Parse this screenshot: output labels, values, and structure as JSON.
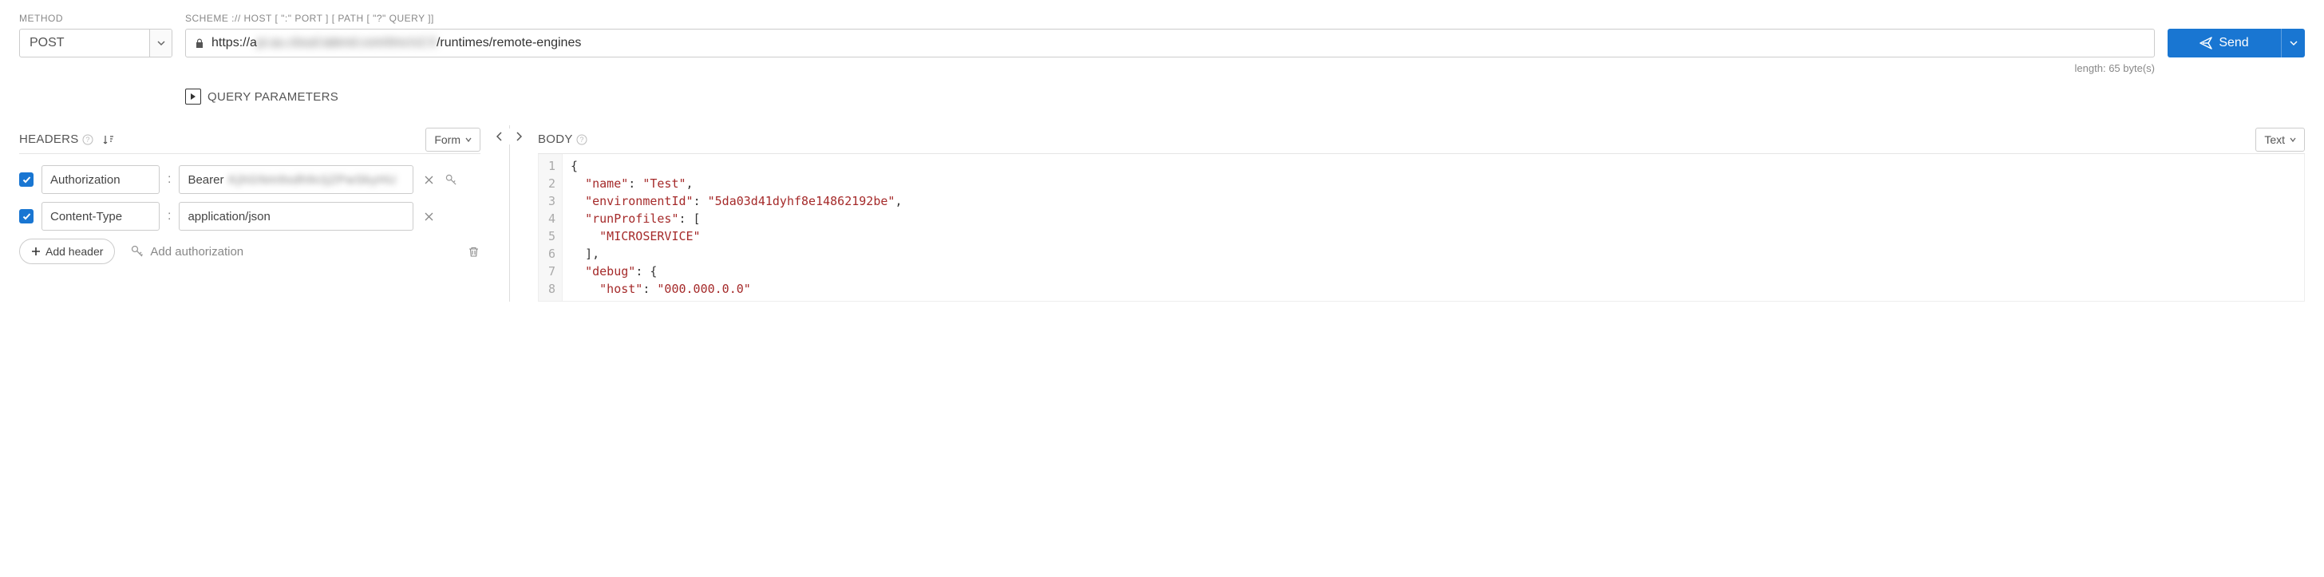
{
  "labels": {
    "method": "METHOD",
    "scheme": "SCHEME :// HOST [ \":\" PORT ] [ PATH [ \"?\" QUERY ]]",
    "query_params": "QUERY PARAMETERS",
    "headers": "HEADERS",
    "body": "BODY",
    "length": "length: 65 byte(s)"
  },
  "method": {
    "value": "POST"
  },
  "url": {
    "prefix": "https://a",
    "blurred": "pi.au.cloud.talend.com/tmc/v2.5",
    "suffix": "/runtimes/remote-engines"
  },
  "send": {
    "label": "Send"
  },
  "headers_panel": {
    "mode": "Form"
  },
  "body_panel": {
    "mode": "Text"
  },
  "headers": [
    {
      "enabled": true,
      "key": "Authorization",
      "value_prefix": "Bearer ",
      "value_blur": "KjhGNm9sdh9cljZPwSkyHU",
      "has_key_icon": true
    },
    {
      "enabled": true,
      "key": "Content-Type",
      "value_prefix": "application/json",
      "value_blur": "",
      "has_key_icon": false
    }
  ],
  "controls": {
    "add_header": "Add header",
    "add_auth": "Add authorization"
  },
  "body_code": {
    "lines": [
      [
        {
          "t": "p",
          "v": "{"
        }
      ],
      [
        {
          "t": "p",
          "v": "  "
        },
        {
          "t": "k",
          "v": "\"name\""
        },
        {
          "t": "p",
          "v": ": "
        },
        {
          "t": "s",
          "v": "\"Test\""
        },
        {
          "t": "p",
          "v": ","
        }
      ],
      [
        {
          "t": "p",
          "v": "  "
        },
        {
          "t": "k",
          "v": "\"environmentId\""
        },
        {
          "t": "p",
          "v": ": "
        },
        {
          "t": "s",
          "v": "\"5da03d41dyhf8e14862192be\""
        },
        {
          "t": "p",
          "v": ","
        }
      ],
      [
        {
          "t": "p",
          "v": "  "
        },
        {
          "t": "k",
          "v": "\"runProfiles\""
        },
        {
          "t": "p",
          "v": ": ["
        }
      ],
      [
        {
          "t": "p",
          "v": "    "
        },
        {
          "t": "s",
          "v": "\"MICROSERVICE\""
        }
      ],
      [
        {
          "t": "p",
          "v": "  ],"
        }
      ],
      [
        {
          "t": "p",
          "v": "  "
        },
        {
          "t": "k",
          "v": "\"debug\""
        },
        {
          "t": "p",
          "v": ": {"
        }
      ],
      [
        {
          "t": "p",
          "v": "    "
        },
        {
          "t": "k",
          "v": "\"host\""
        },
        {
          "t": "p",
          "v": ": "
        },
        {
          "t": "s",
          "v": "\"000.000.0.0\""
        }
      ]
    ]
  }
}
